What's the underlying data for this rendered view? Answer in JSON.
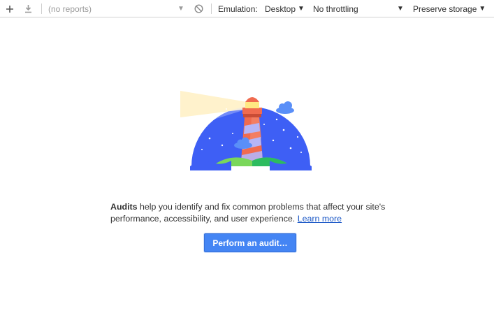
{
  "toolbar": {
    "add_icon": "plus-icon",
    "download_icon": "download-icon",
    "reports_select": "(no reports)",
    "clear_icon": "clear-circle-icon",
    "emulation_label": "Emulation:",
    "emulation_value": "Desktop",
    "throttling_value": "No throttling",
    "storage_value": "Preserve storage"
  },
  "hero": {
    "image": "lighthouse-illustration",
    "colors": {
      "sky": "#3e5ff5",
      "beam": "#fff1c8",
      "tower_red": "#f06b4f",
      "tower_stripe": "#b5b5f7",
      "lamp_yellow": "#ffe882",
      "cloud": "#5a8ff8",
      "grass_light": "#7ad75a",
      "grass_dark": "#2dbb5f"
    }
  },
  "main": {
    "description_bold": "Audits",
    "description_line1": " help you identify and fix common problems that affect your site's",
    "description_line2": "performance, accessibility, and user experience.",
    "learn_more": "Learn more",
    "perform_button": "Perform an audit…"
  }
}
